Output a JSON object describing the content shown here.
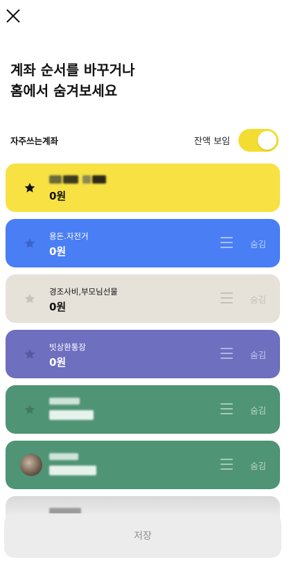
{
  "header": {
    "title_line1": "계좌 순서를 바꾸거나",
    "title_line2": "홈에서 숨겨보세요"
  },
  "section": {
    "label": "자주쓰는계좌",
    "balance_toggle_label": "잔액 보임",
    "balance_visible": true
  },
  "accounts": [
    {
      "name": "",
      "amount": "0원",
      "starred": true,
      "color": "#f8e143",
      "show_controls": false
    },
    {
      "name": "용돈.자전거",
      "amount": "0원",
      "starred": false,
      "color": "#4a7ef5",
      "show_controls": true
    },
    {
      "name": "경조사비,부모님선물",
      "amount": "0원",
      "starred": false,
      "color": "#e6e2da",
      "show_controls": true
    },
    {
      "name": "빗상환통장",
      "amount": "0원",
      "starred": false,
      "color": "#6e6fbf",
      "show_controls": true
    },
    {
      "name": "",
      "amount": "",
      "starred": false,
      "color": "#4f9475",
      "show_controls": true
    },
    {
      "name": "",
      "amount": "",
      "starred": false,
      "color": "#4f9475",
      "show_controls": true,
      "avatar": true
    }
  ],
  "controls": {
    "hide_label": "숨김"
  },
  "icons": {
    "close": "close-icon",
    "star": "star-icon",
    "reorder": "drag-handle-icon"
  },
  "footer": {
    "save_label": "저장"
  }
}
